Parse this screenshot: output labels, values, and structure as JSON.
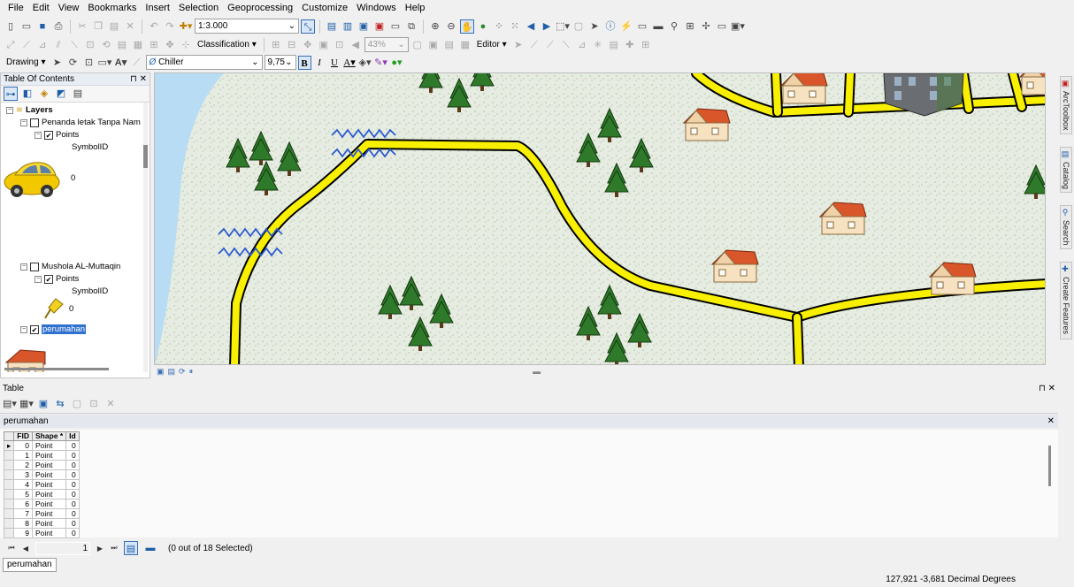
{
  "menu": [
    "File",
    "Edit",
    "View",
    "Bookmarks",
    "Insert",
    "Selection",
    "Geoprocessing",
    "Customize",
    "Windows",
    "Help"
  ],
  "toolbar": {
    "scale": "1:3.000",
    "classification_label": "Classification",
    "zoom_percent": "43%",
    "editor_label": "Editor",
    "drawing_label": "Drawing",
    "font_name": "Chiller",
    "font_size": "9,75",
    "bold": "B",
    "italic": "I",
    "underline": "U",
    "font_color_glyph": "A"
  },
  "toc": {
    "title": "Table Of Contents",
    "root_label": "Layers",
    "layers": [
      {
        "name": "Penanda letak Tanpa Nam",
        "sub": "Points",
        "field": "SymbolID",
        "legend_value": "0",
        "symbol": "car-symbol"
      },
      {
        "name": "Mushola AL-Muttaqin",
        "sub": "Points",
        "field": "SymbolID",
        "legend_value": "0",
        "symbol": "pushpin-symbol"
      },
      {
        "name": "perumahan",
        "symbol": "house-symbol"
      }
    ]
  },
  "map": {
    "features": [
      "trees",
      "houses",
      "roads",
      "water",
      "river-waves",
      "building"
    ]
  },
  "right_tabs": [
    "ArcToolbox",
    "Catalog",
    "Search",
    "Create Features"
  ],
  "table": {
    "title": "Table",
    "layer_name": "perumahan",
    "columns": [
      "FID",
      "Shape *",
      "Id"
    ],
    "rows": [
      [
        "0",
        "Point",
        "0"
      ],
      [
        "1",
        "Point",
        "0"
      ],
      [
        "2",
        "Point",
        "0"
      ],
      [
        "3",
        "Point",
        "0"
      ],
      [
        "4",
        "Point",
        "0"
      ],
      [
        "5",
        "Point",
        "0"
      ],
      [
        "6",
        "Point",
        "0"
      ],
      [
        "7",
        "Point",
        "0"
      ],
      [
        "8",
        "Point",
        "0"
      ],
      [
        "9",
        "Point",
        "0"
      ]
    ],
    "current_record": "1",
    "selection_text": "(0 out of 18 Selected)",
    "bottom_tab": "perumahan"
  },
  "status": {
    "coordinates": "127,921  -3,681 Decimal Degrees"
  },
  "colors": {
    "road": "#f8f000",
    "water": "#b8dcf4",
    "land": "#e8eee3",
    "selection": "#3071d0"
  }
}
